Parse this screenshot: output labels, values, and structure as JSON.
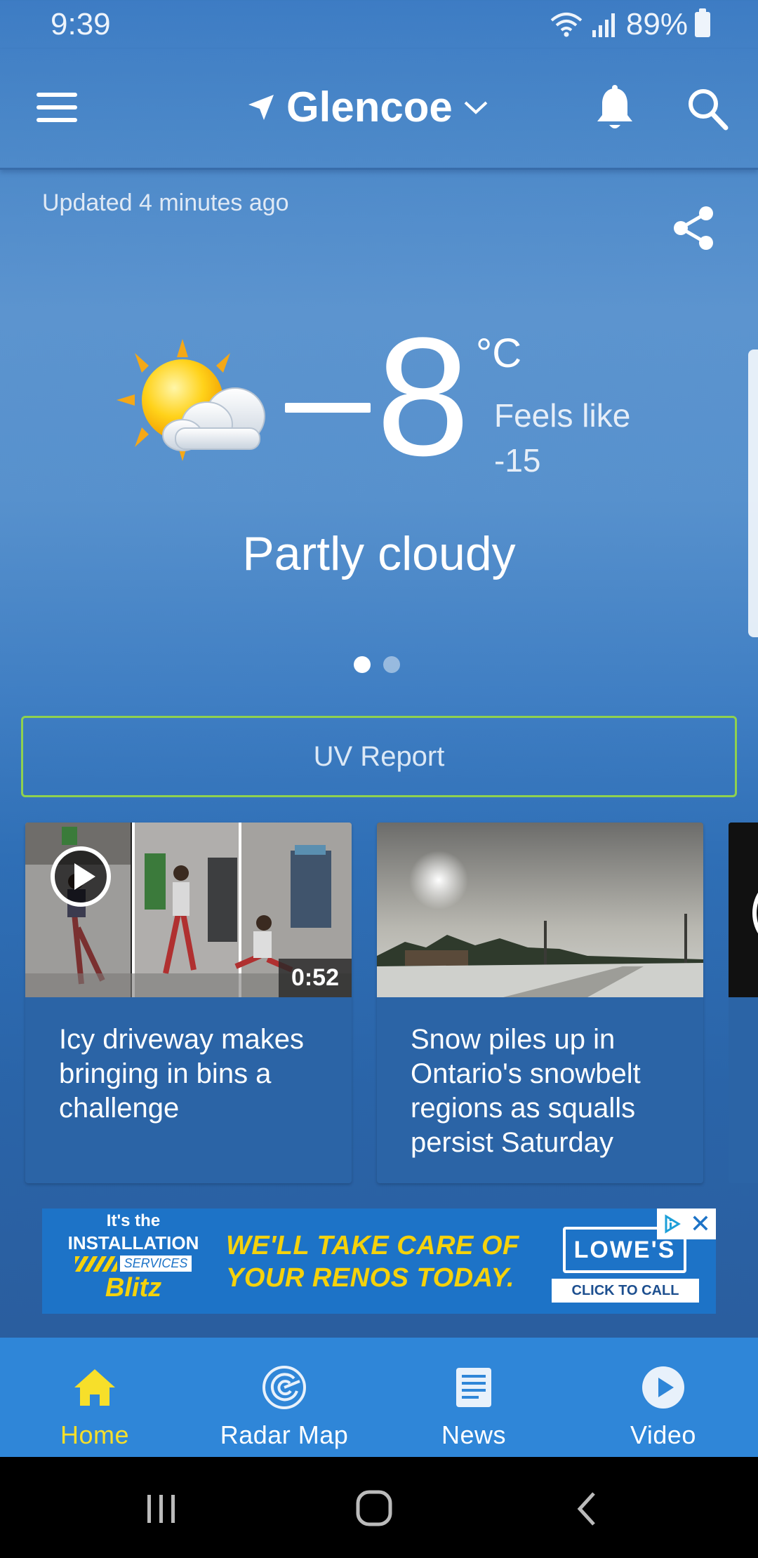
{
  "status_bar": {
    "time": "9:39",
    "battery": "89%"
  },
  "header": {
    "location": "Glencoe"
  },
  "current": {
    "updated": "Updated 4 minutes ago",
    "temperature": "8",
    "unit": "°C",
    "feels_like": "Feels like -15",
    "condition": "Partly cloudy",
    "icon": "partly-cloudy-sun-icon",
    "page_count": 2,
    "active_page": 1
  },
  "uv_button": {
    "label": "UV Report"
  },
  "videos": [
    {
      "title": "Icy driveway makes bringing in bins a challenge",
      "duration": "0:52"
    },
    {
      "title": "Snow piles up in Ontario's snowbelt regions as squalls persist Saturday"
    }
  ],
  "ad": {
    "line1": "It's the",
    "line2": "INSTALLATION",
    "line3": "SERVICES",
    "line4": "Blitz",
    "headline1": "WE'LL TAKE CARE OF",
    "headline2": "YOUR RENOS TODAY.",
    "brand": "LOWE'S",
    "cta": "CLICK TO CALL",
    "close": "✕"
  },
  "bottom_nav": [
    {
      "label": "Home",
      "icon": "home-icon",
      "active": true
    },
    {
      "label": "Radar Map",
      "icon": "radar-icon"
    },
    {
      "label": "News",
      "icon": "news-icon"
    },
    {
      "label": "Video",
      "icon": "video-play-icon"
    }
  ],
  "colors": {
    "accent_active": "#f7df2a",
    "nav_bg": "#2f86d8",
    "uv_border": "#8fd14f",
    "ad_yellow": "#f5d20c"
  }
}
